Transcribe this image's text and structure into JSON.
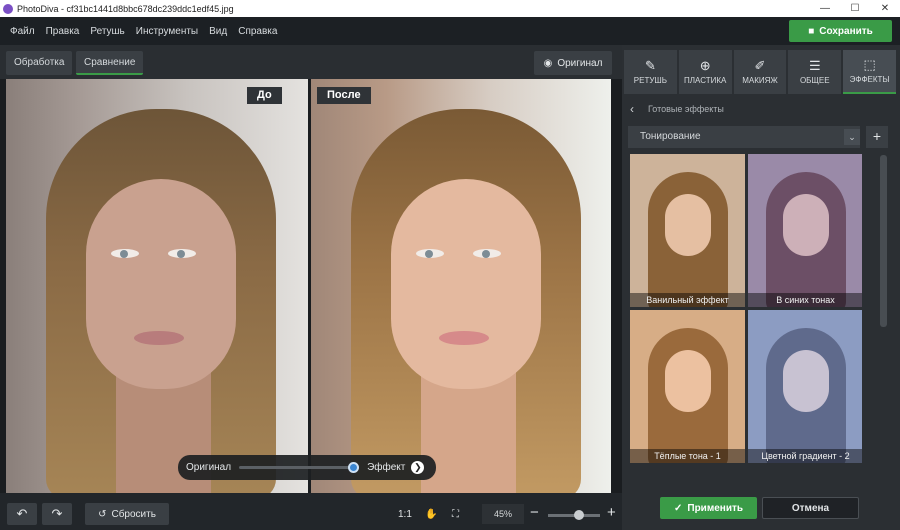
{
  "window": {
    "app_name": "PhotoDiva",
    "title": "PhotoDiva - cf31bc1441d8bbc678dc239ddc1edf45.jpg",
    "minimize": "—",
    "maximize": "☐",
    "close": "✕"
  },
  "menu": [
    "Файл",
    "Правка",
    "Ретушь",
    "Инструменты",
    "Вид",
    "Справка"
  ],
  "save_button": "Сохранить",
  "view_tabs": [
    "Обработка",
    "Сравнение"
  ],
  "active_view_tab": "Сравнение",
  "original_button": "Оригинал",
  "compare": {
    "before_label": "До",
    "after_label": "После"
  },
  "blend_slider": {
    "left_label": "Оригинал",
    "right_label": "Эффект",
    "value": 1.0
  },
  "bottom": {
    "reset": "Сбросить",
    "fit_label": "1:1",
    "zoom": "45%",
    "zoom_slider_value": 0.6
  },
  "panel": {
    "tabs": [
      {
        "icon": "retouch-icon",
        "label": "РЕТУШЬ",
        "glyph": "✎"
      },
      {
        "icon": "plastic-icon",
        "label": "ПЛАСТИКА",
        "glyph": "⊕"
      },
      {
        "icon": "makeup-icon",
        "label": "МАКИЯЖ",
        "glyph": "✐"
      },
      {
        "icon": "general-icon",
        "label": "ОБЩЕЕ",
        "glyph": "☰"
      },
      {
        "icon": "effects-icon",
        "label": "ЭФФЕКТЫ",
        "glyph": "⬚"
      }
    ],
    "active_tab": "ЭФФЕКТЫ",
    "breadcrumb": "Готовые эффекты",
    "category": "Тонирование",
    "effects": [
      {
        "name": "Ванильный эффект",
        "bg": "#cdb39a",
        "hair": "#8a6238",
        "face": "#e5bfa2"
      },
      {
        "name": "В синих тонах",
        "bg": "#9a8aa8",
        "hair": "#6c4f66",
        "face": "#cdb0b8"
      },
      {
        "name": "Тёплые тона - 1",
        "bg": "#d7ad86",
        "hair": "#9a6a3c",
        "face": "#ecc1a0"
      },
      {
        "name": "Цветной градиент - 2",
        "bg": "#8c9cc2",
        "hair": "#5f6a8c",
        "face": "#c8c2d2"
      }
    ]
  },
  "apply_button": "Применить",
  "cancel_button": "Отмена"
}
